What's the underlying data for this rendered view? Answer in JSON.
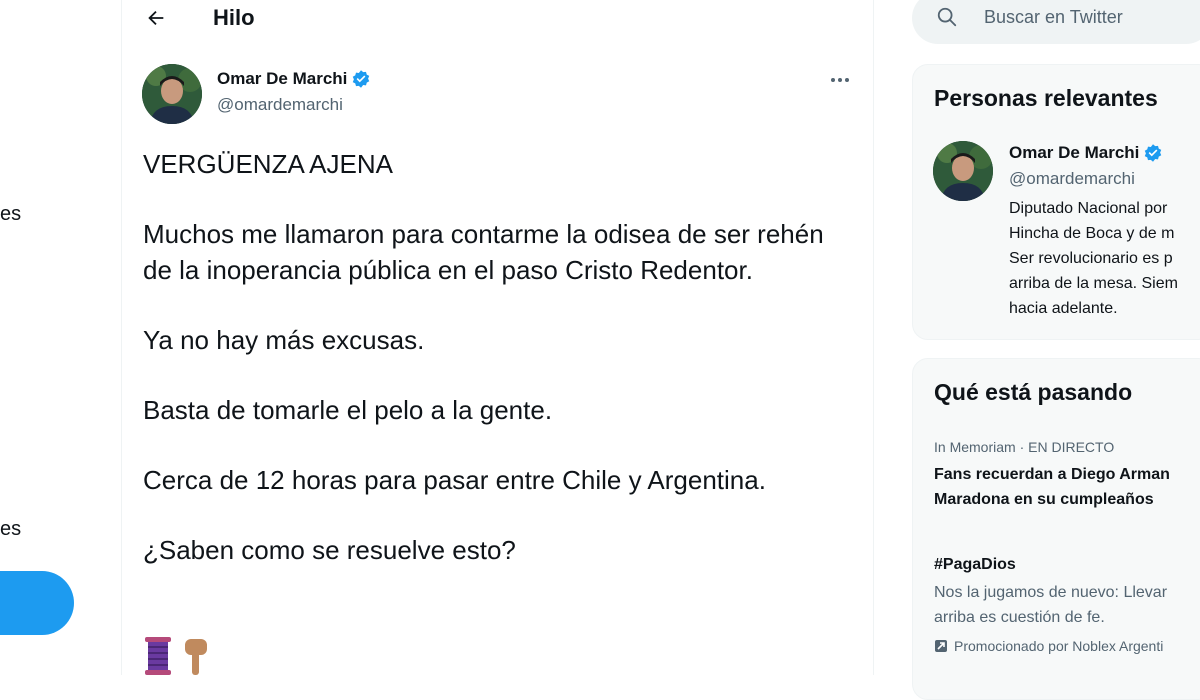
{
  "left_sidebar": {
    "fragment_1": "es",
    "fragment_2": "es"
  },
  "header": {
    "title": "Hilo"
  },
  "tweet": {
    "author_name": "Omar De Marchi",
    "author_handle": "@omardemarchi",
    "paragraphs": [
      "VERGÜENZA AJENA",
      "Muchos me llamaron para contarme la odisea de ser rehén de la inoperancia pública en el paso Cristo Redentor.",
      "Ya no hay más excusas.",
      "Basta de tomarle el pelo a la gente.",
      "Cerca de 12 horas para pasar entre Chile y Argentina.",
      "¿Saben como se resuelve esto?"
    ],
    "emojis": [
      "🧵",
      "👇🏽"
    ]
  },
  "search": {
    "placeholder": "Buscar en Twitter"
  },
  "relevant_people": {
    "title": "Personas relevantes",
    "name": "Omar De Marchi",
    "handle": "@omardemarchi",
    "bio_lines": [
      "Diputado Nacional por",
      "Hincha de Boca y de m",
      "Ser revolucionario es p",
      "arriba de la mesa. Siem",
      "hacia adelante."
    ]
  },
  "trends": {
    "title": "Qué está pasando",
    "items": [
      {
        "meta": "In Memoriam · EN DIRECTO",
        "title_lines": [
          "Fans recuerdan a Diego Arman",
          "Maradona en su cumpleaños"
        ]
      },
      {
        "title": "#PagaDios",
        "desc_lines": [
          "Nos la jugamos de nuevo: Llevar",
          "arriba es cuestión de fe."
        ],
        "promoted": "Promocionado por Noblex Argenti"
      }
    ]
  },
  "colors": {
    "accent": "#1d9bf0",
    "text_primary": "#0f1419",
    "text_secondary": "#536471",
    "card_bg": "#f7f9f9"
  }
}
